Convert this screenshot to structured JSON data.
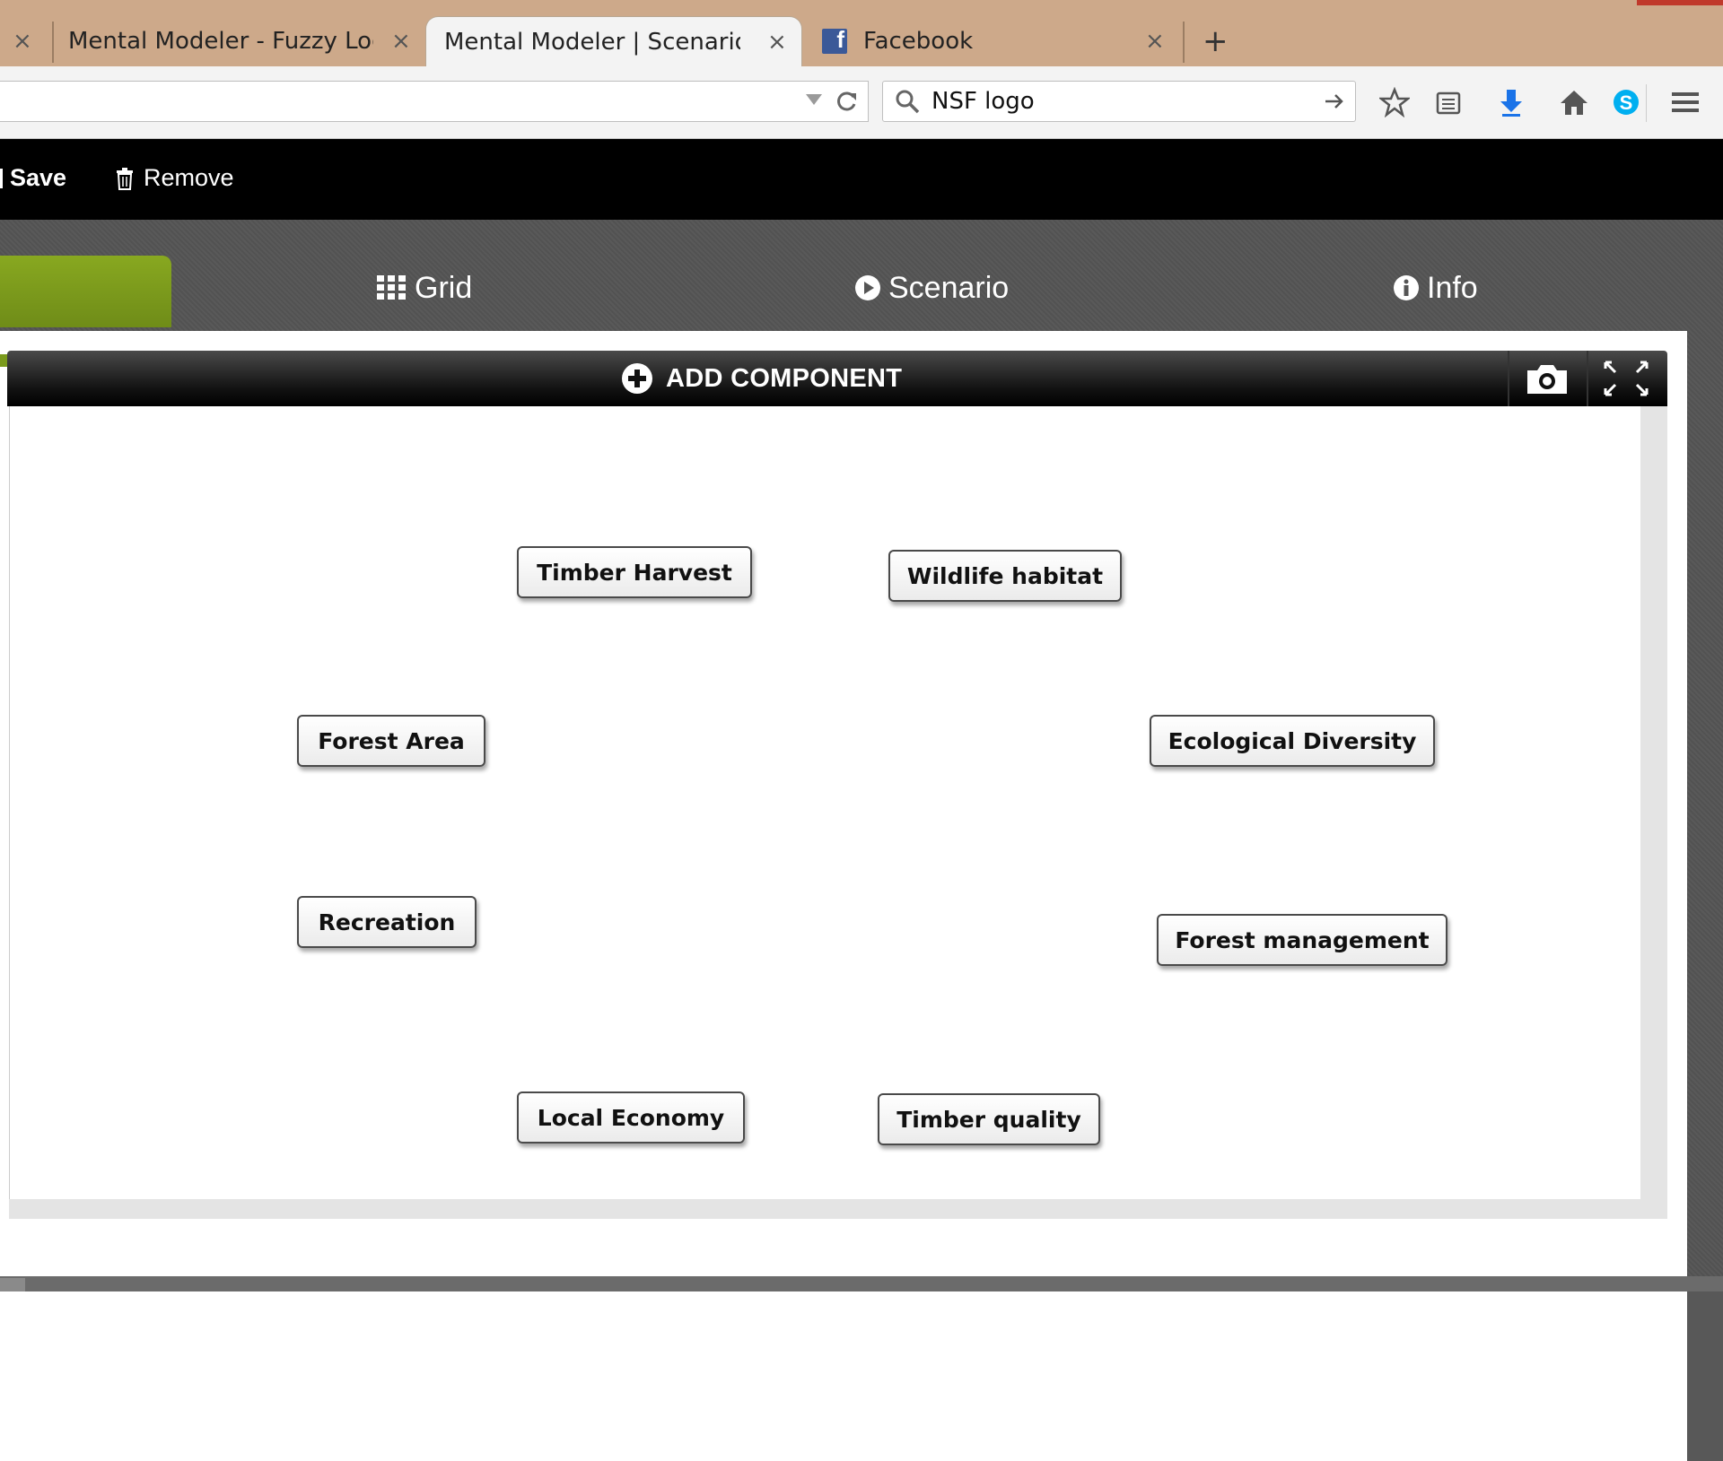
{
  "browser": {
    "tabs": [
      {
        "title": "Mental Modeler - Fuzzy Logic ...",
        "active": false
      },
      {
        "title": "Mental Modeler | Scenario",
        "active": true
      },
      {
        "title": "Facebook",
        "active": false
      }
    ],
    "close_glyph": "×",
    "new_tab_glyph": "+",
    "search_value": "NSF logo"
  },
  "toolbar": {
    "save_label": "Save",
    "remove_label": "Remove"
  },
  "nav_tabs": {
    "grid": "Grid",
    "scenario": "Scenario",
    "info": "Info"
  },
  "canvas": {
    "add_component_label": "ADD COMPONENT",
    "nodes": [
      {
        "label": "Timber Harvest"
      },
      {
        "label": "Wildlife habitat"
      },
      {
        "label": "Forest Area"
      },
      {
        "label": "Ecological Diversity"
      },
      {
        "label": "Recreation"
      },
      {
        "label": "Forest management"
      },
      {
        "label": "Local Economy"
      },
      {
        "label": "Timber quality"
      }
    ]
  },
  "colors": {
    "tab_strip": "#cda98a",
    "accent_green": "#7a9a1c",
    "toolbar": "#000000",
    "facebook_blue": "#3b5998",
    "download_blue": "#1a73e8",
    "skype_blue": "#00aff0"
  }
}
